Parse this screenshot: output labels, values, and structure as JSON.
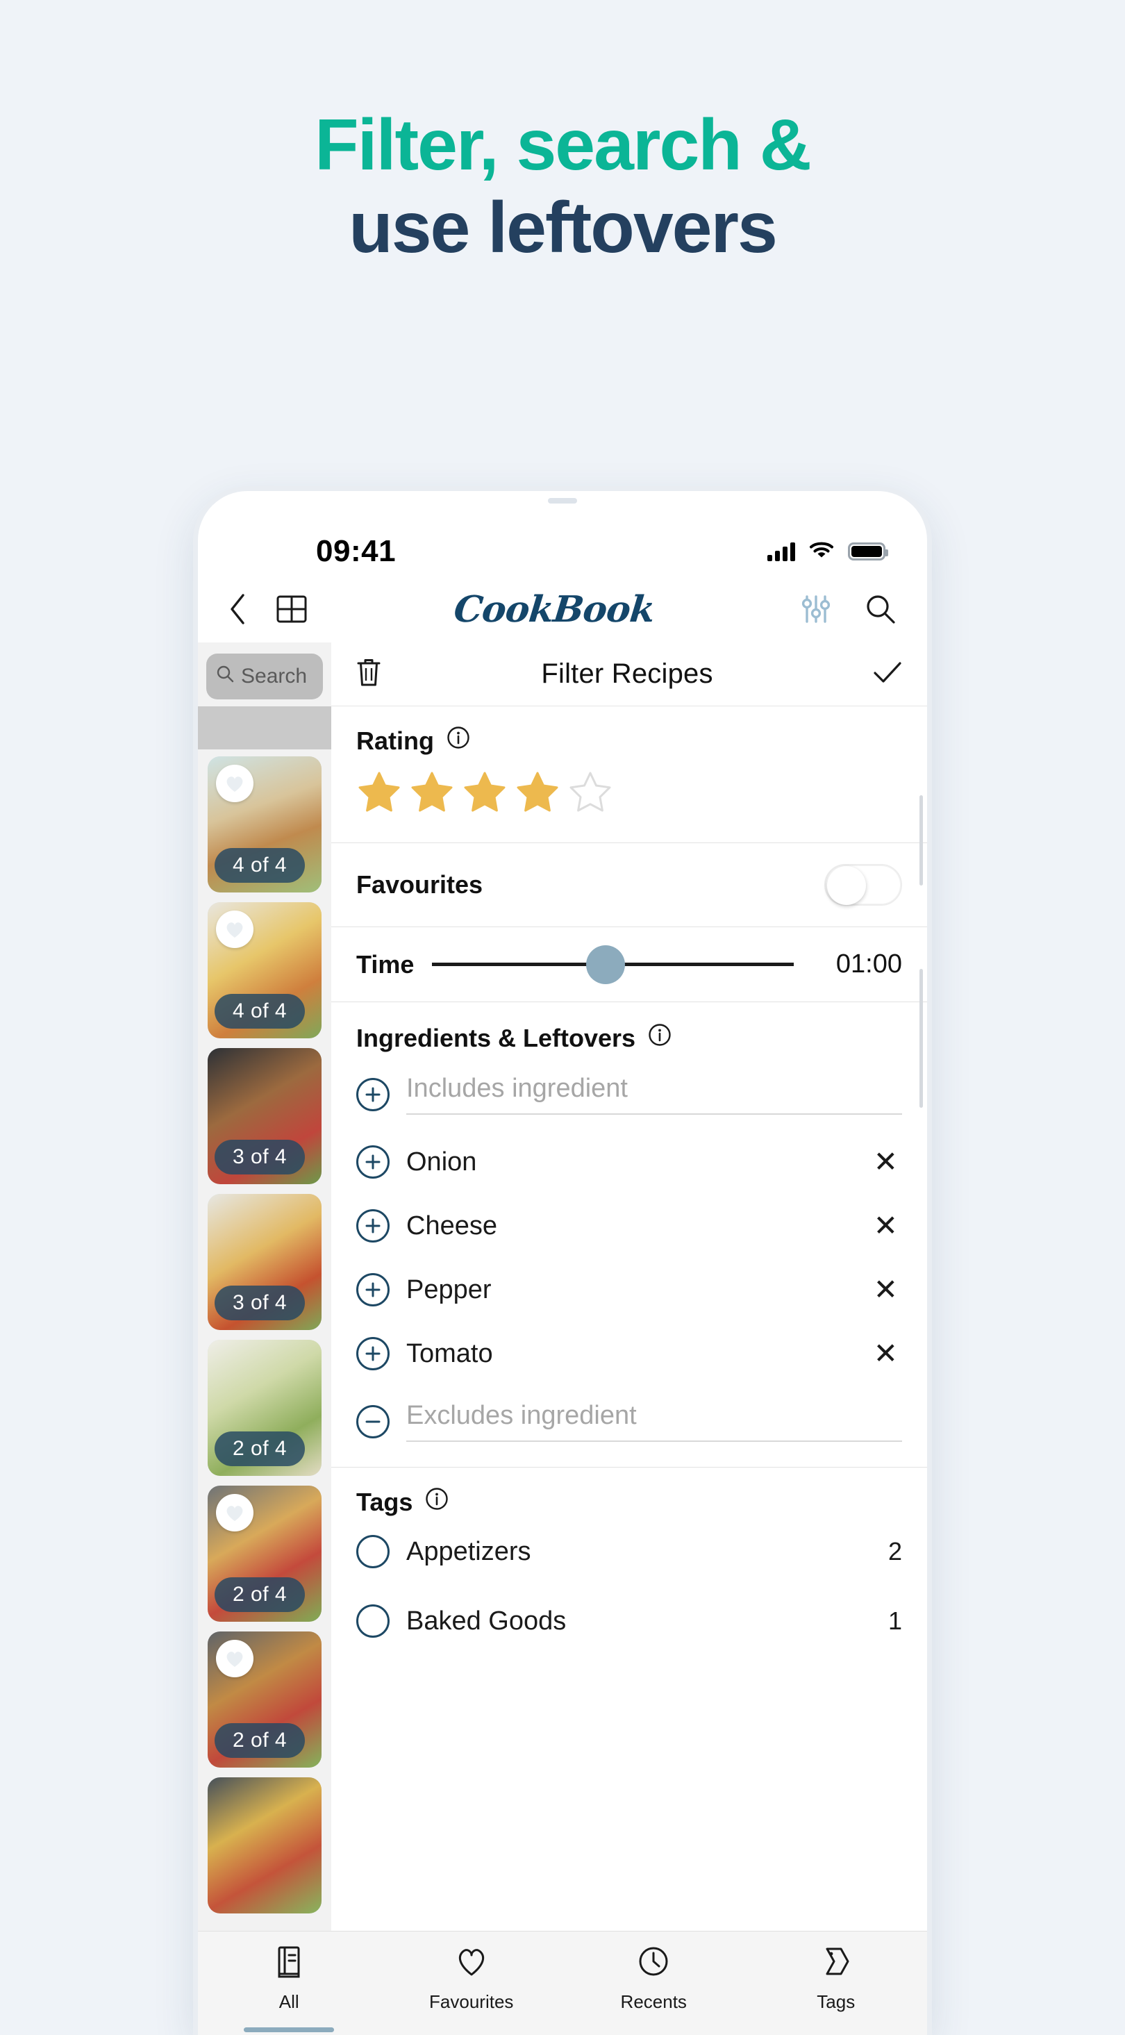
{
  "headline": {
    "line1": "Filter, search &",
    "line2": "use leftovers",
    "color_line1": "#0bb596",
    "color_line2": "#24405f"
  },
  "phone": {
    "statusbar": {
      "time": "09:41",
      "cellular_icon": "cellular-bars-icon",
      "wifi_icon": "wifi-icon",
      "battery_icon": "battery-full-icon"
    },
    "appbar": {
      "back_icon": "chevron-left-icon",
      "grid_icon": "grid-view-icon",
      "brand": "CookBook",
      "filter_icon": "filter-sliders-icon",
      "filter_icon_color": "#9cbdd2",
      "search_icon": "search-icon"
    }
  },
  "rail": {
    "search_placeholder": "Search",
    "search_icon": "search-icon",
    "recipes": [
      {
        "count": "4 of 4",
        "favourite": true,
        "photo": "burger"
      },
      {
        "count": "4 of 4",
        "favourite": true,
        "photo": "tacos"
      },
      {
        "count": "3 of 4",
        "favourite": false,
        "photo": "chicken-salad-bowl"
      },
      {
        "count": "3 of 4",
        "favourite": false,
        "photo": "pizza"
      },
      {
        "count": "2 of 4",
        "favourite": false,
        "photo": "caesar-salad"
      },
      {
        "count": "2 of 4",
        "favourite": true,
        "photo": "chickpea-bowl"
      },
      {
        "count": "2 of 4",
        "favourite": true,
        "photo": "falafel-bowl"
      },
      {
        "count": "",
        "favourite": false,
        "photo": "veggie-skillet"
      }
    ]
  },
  "filter_sheet": {
    "clear_icon": "trash-icon",
    "title": "Filter Recipes",
    "confirm_icon": "check-icon",
    "rating": {
      "label": "Rating",
      "info_icon": "info-icon",
      "value": 4,
      "max": 5,
      "star_color": "#edb94e",
      "empty_star_color": "#dcdcdc"
    },
    "favourites": {
      "label": "Favourites",
      "enabled": false
    },
    "time": {
      "label": "Time",
      "value": "01:00",
      "thumb_position_pct": 48,
      "thumb_color": "#8cabbd"
    },
    "ingredients": {
      "label": "Ingredients & Leftovers",
      "info_icon": "info-icon",
      "includes_placeholder": "Includes ingredient",
      "includes_icon": "plus-circle-icon",
      "items": [
        {
          "name": "Onion",
          "add_icon": "plus-circle-icon",
          "remove_icon": "close-icon"
        },
        {
          "name": "Cheese",
          "add_icon": "plus-circle-icon",
          "remove_icon": "close-icon"
        },
        {
          "name": "Pepper",
          "add_icon": "plus-circle-icon",
          "remove_icon": "close-icon"
        },
        {
          "name": "Tomato",
          "add_icon": "plus-circle-icon",
          "remove_icon": "close-icon"
        }
      ],
      "excludes_placeholder": "Excludes ingredient",
      "excludes_icon": "minus-circle-icon"
    },
    "tags": {
      "label": "Tags",
      "info_icon": "info-icon",
      "items": [
        {
          "name": "Appetizers",
          "count": "2",
          "checkbox_icon": "radio-empty-icon"
        },
        {
          "name": "Baked Goods",
          "count": "1",
          "checkbox_icon": "radio-empty-icon"
        }
      ]
    }
  },
  "tabbar": {
    "active_index": 0,
    "active_color": "#8cabbd",
    "tabs": [
      {
        "label": "All",
        "icon": "book-icon"
      },
      {
        "label": "Favourites",
        "icon": "heart-icon"
      },
      {
        "label": "Recents",
        "icon": "clock-icon"
      },
      {
        "label": "Tags",
        "icon": "tag-icon"
      }
    ]
  }
}
